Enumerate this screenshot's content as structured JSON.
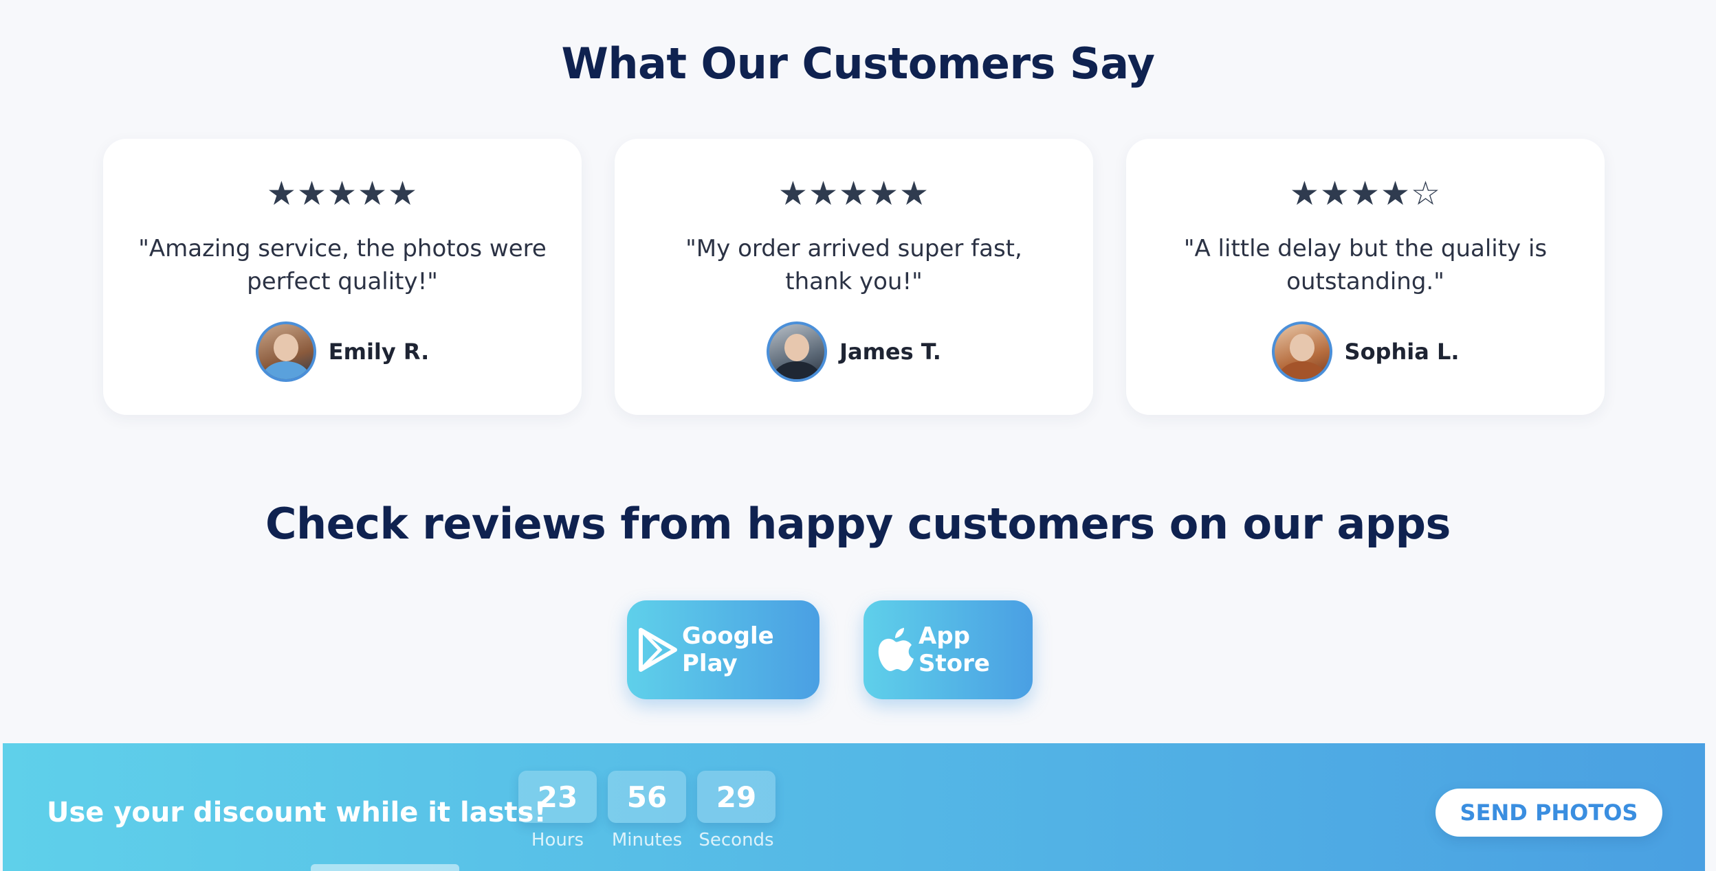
{
  "reviews_section": {
    "title": "What Our Customers Say",
    "cards": [
      {
        "stars": "★★★★★",
        "rating": 5,
        "quote": "\"Amazing service, the photos were perfect quality!\"",
        "author": "Emily R."
      },
      {
        "stars": "★★★★★",
        "rating": 5,
        "quote": "\"My order arrived super fast, thank you!\"",
        "author": "James T."
      },
      {
        "stars": "★★★★☆",
        "rating": 4,
        "quote": "\"A little delay but the quality is outstanding.\"",
        "author": "Sophia L."
      }
    ]
  },
  "apps_section": {
    "title": "Check reviews from happy customers on our apps",
    "google_play": {
      "label": "Google Play",
      "icon": "google-play-icon"
    },
    "app_store": {
      "label": "App Store",
      "icon": "apple-icon"
    }
  },
  "banner": {
    "text": "Use your discount while it lasts!",
    "countdown": [
      {
        "value": "23",
        "label": "Hours"
      },
      {
        "value": "56",
        "label": "Minutes"
      },
      {
        "value": "29",
        "label": "Seconds"
      }
    ],
    "cta": "SEND PHOTOS"
  },
  "colors": {
    "heading": "#0f2250",
    "accent_start": "#5fd0ea",
    "accent_end": "#4a9fe3",
    "page_bg": "#f7f8fb"
  }
}
